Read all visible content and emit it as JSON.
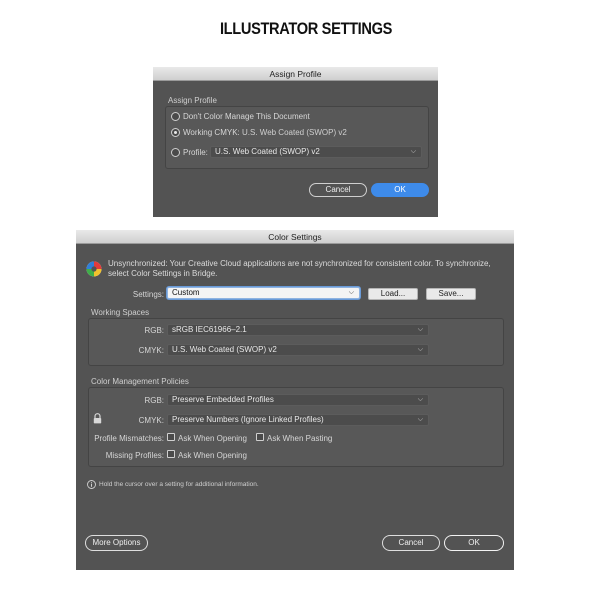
{
  "page": {
    "heading": "ILLUSTRATOR SETTINGS"
  },
  "assign_profile": {
    "title": "Assign Profile",
    "group_label": "Assign Profile",
    "option_dont_manage": "Don't Color Manage This Document",
    "option_working_label": "Working CMYK:",
    "option_working_value": "U.S. Web Coated (SWOP) v2",
    "option_profile_label": "Profile:",
    "option_profile_value": "U.S. Web Coated (SWOP) v2",
    "selected_option": "working",
    "cancel_label": "Cancel",
    "ok_label": "OK"
  },
  "color_settings": {
    "title": "Color Settings",
    "sync_message": "Unsynchronized: Your Creative Cloud applications are not synchronized for consistent color. To synchronize, select Color Settings in Bridge.",
    "settings_label": "Settings:",
    "settings_value": "Custom",
    "load_label": "Load...",
    "save_label": "Save...",
    "working_spaces": {
      "title": "Working Spaces",
      "rgb_label": "RGB:",
      "rgb_value": "sRGB IEC61966–2.1",
      "cmyk_label": "CMYK:",
      "cmyk_value": "U.S. Web Coated (SWOP) v2"
    },
    "policies": {
      "title": "Color Management Policies",
      "rgb_label": "RGB:",
      "rgb_value": "Preserve Embedded Profiles",
      "cmyk_label": "CMYK:",
      "cmyk_value": "Preserve Numbers (Ignore Linked Profiles)",
      "mismatch_label": "Profile Mismatches:",
      "ask_opening_label": "Ask When Opening",
      "ask_pasting_label": "Ask When Pasting",
      "missing_label": "Missing Profiles:",
      "missing_ask_opening_label": "Ask When Opening"
    },
    "info_text": "Hold the cursor over a setting for additional information.",
    "more_options_label": "More Options",
    "cancel_label": "Cancel",
    "ok_label": "OK"
  },
  "colors": {
    "dialog_bg": "#535353",
    "accent_blue": "#3e8bea"
  }
}
